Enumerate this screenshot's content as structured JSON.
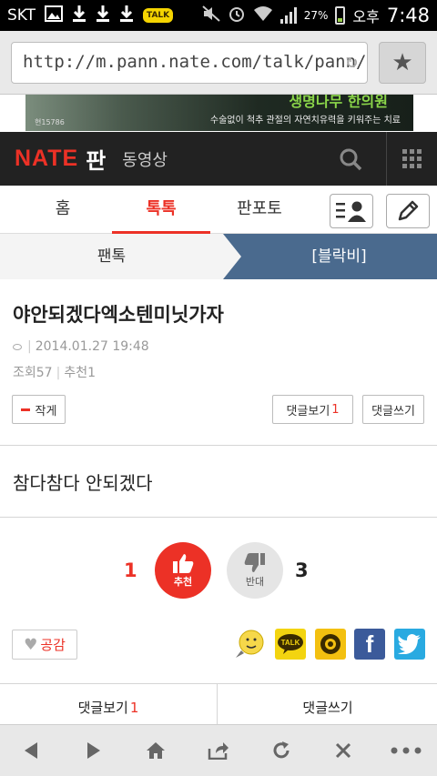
{
  "status_bar": {
    "carrier": "SKT",
    "battery": "27%",
    "time_prefix": "오후",
    "time": "7:48",
    "kakao_badge": "TALK"
  },
  "browser": {
    "url": "http://m.pann.nate.com/talk/pann/3"
  },
  "ad": {
    "code": "현15786",
    "title": "생명나무 한의원",
    "text": "수술없이 척추 관절의 자연치유력을 키워주는 치료"
  },
  "header": {
    "logo": "NATE",
    "section": "판",
    "video": "동영상"
  },
  "tabs": {
    "items": [
      {
        "label": "홈"
      },
      {
        "label": "톡톡"
      },
      {
        "label": "판포토"
      }
    ],
    "active_index": 1
  },
  "subtabs": {
    "left": "팬톡",
    "right": "[블락비]"
  },
  "post": {
    "title": "야안되겠다엑소텐미닛가자",
    "date": "2014.01.27 19:48",
    "views_label": "조회",
    "views": "57",
    "recommend_label": "추천",
    "recommend": "1",
    "font_small_label": "작게",
    "view_comments_label": "댓글보기",
    "comment_count": "1",
    "write_comment_label": "댓글쓰기",
    "body": "참다참다 안되겠다"
  },
  "vote": {
    "up_count": "1",
    "up_label": "추천",
    "down_label": "반대",
    "down_count": "3"
  },
  "empathy_label": "공감",
  "share": {
    "kakaotalk_label": "TALK",
    "facebook_glyph": "f"
  },
  "bottom_bar": {
    "view_comments_label": "댓글보기",
    "comment_count": "1",
    "write_comment_label": "댓글쓰기"
  },
  "colors": {
    "accent": "#ec3126",
    "header_bg": "#222222",
    "subtab_bg": "#4a6a8e"
  }
}
